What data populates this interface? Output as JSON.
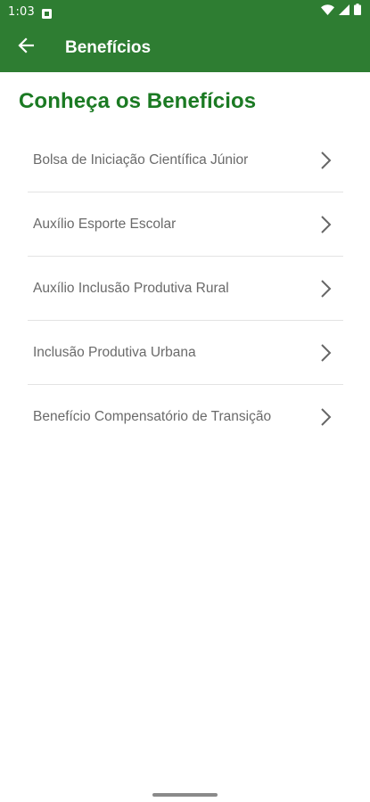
{
  "status_bar": {
    "time": "1:03",
    "icons": [
      "notification-icon",
      "wifi-icon",
      "signal-icon",
      "battery-icon"
    ]
  },
  "app_bar": {
    "title": "Benefícios",
    "back_icon": "arrow-left-icon"
  },
  "page": {
    "heading": "Conheça os Benefícios"
  },
  "benefits": [
    {
      "label": "Bolsa de Iniciação Científica Júnior"
    },
    {
      "label": "Auxílio Esporte Escolar"
    },
    {
      "label": "Auxílio Inclusão Produtiva Rural"
    },
    {
      "label": "Inclusão Produtiva Urbana"
    },
    {
      "label": "Benefício Compensatório de Transição"
    }
  ],
  "colors": {
    "primary": "#2e7d32",
    "heading": "#1b7a23",
    "item_text": "#6a6a6a",
    "divider": "#e3e3e3"
  }
}
